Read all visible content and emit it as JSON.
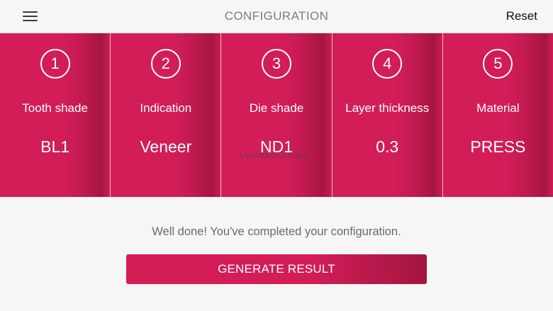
{
  "header": {
    "menu_icon": "hamburger-menu-icon",
    "title": "CONFIGURATION",
    "reset_label": "Reset"
  },
  "steps": [
    {
      "number": "1",
      "label": "Tooth shade",
      "value": "BL1"
    },
    {
      "number": "2",
      "label": "Indication",
      "value": "Veneer"
    },
    {
      "number": "3",
      "label": "Die shade",
      "value": "ND1"
    },
    {
      "number": "4",
      "label": "Layer thickness",
      "value": "0.3"
    },
    {
      "number": "5",
      "label": "Material",
      "value": "PRESS"
    }
  ],
  "watermark": "UpdateStar.com",
  "message": "Well done! You've completed your configuration.",
  "generate_label": "GENERATE RESULT",
  "colors": {
    "accent": "#d21d57",
    "background": "#f6f6f6",
    "title_gray": "#7d7d7d"
  }
}
